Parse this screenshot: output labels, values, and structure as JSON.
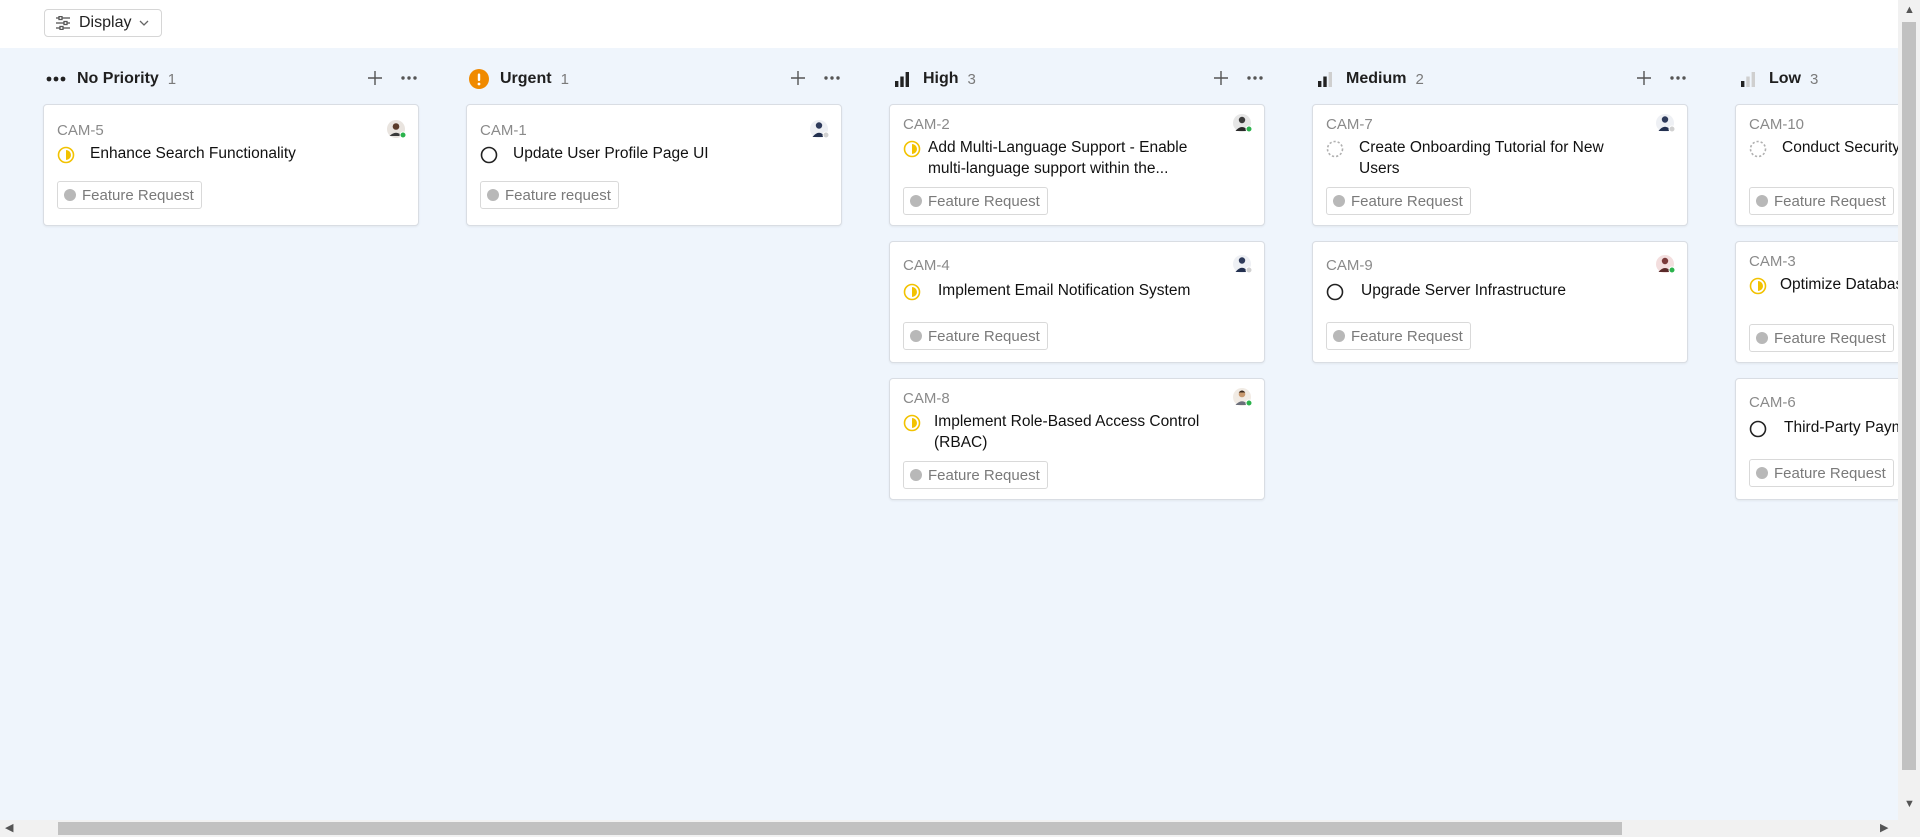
{
  "toolbar": {
    "display_label": "Display"
  },
  "columns": [
    {
      "title": "No Priority",
      "count": "1",
      "icon": "dots-icon",
      "cards": [
        {
          "id": "CAM-5",
          "title": "Enhance Search Functionality",
          "status": "in-progress",
          "tag": "Feature Request"
        }
      ]
    },
    {
      "title": "Urgent",
      "count": "1",
      "icon": "urgent-alert-icon",
      "cards": [
        {
          "id": "CAM-1",
          "title": "Update User Profile Page UI",
          "status": "todo",
          "tag": "Feature request"
        }
      ]
    },
    {
      "title": "High",
      "count": "3",
      "icon": "signal-high-icon",
      "cards": [
        {
          "id": "CAM-2",
          "title": "Add Multi-Language Support - Enable multi-language support within the...",
          "status": "in-progress",
          "tag": "Feature Request"
        },
        {
          "id": "CAM-4",
          "title": "Implement Email Notification System",
          "status": "in-progress",
          "tag": "Feature Request"
        },
        {
          "id": "CAM-8",
          "title": "Implement Role-Based Access Control (RBAC)",
          "status": "in-progress",
          "tag": "Feature Request"
        }
      ]
    },
    {
      "title": "Medium",
      "count": "2",
      "icon": "signal-medium-icon",
      "cards": [
        {
          "id": "CAM-7",
          "title": "Create Onboarding Tutorial for New Users",
          "status": "backlog",
          "tag": "Feature Request"
        },
        {
          "id": "CAM-9",
          "title": "Upgrade Server Infrastructure",
          "status": "todo",
          "tag": "Feature Request"
        }
      ]
    },
    {
      "title": "Low",
      "count": "3",
      "icon": "signal-low-icon",
      "cards": [
        {
          "id": "CAM-10",
          "title": "Conduct Security Assessment",
          "status": "backlog",
          "tag": "Feature Request"
        },
        {
          "id": "CAM-3",
          "title": "Optimize Database Performance",
          "status": "in-progress",
          "tag": "Feature Request"
        },
        {
          "id": "CAM-6",
          "title": "Third-Party Payment Integration",
          "status": "todo",
          "tag": "Feature Request"
        }
      ]
    }
  ],
  "colors": {
    "board_bg": "#eff5fc",
    "urgent": "#f08a00",
    "in_progress": "#f2c200",
    "online": "#2bb24c"
  }
}
